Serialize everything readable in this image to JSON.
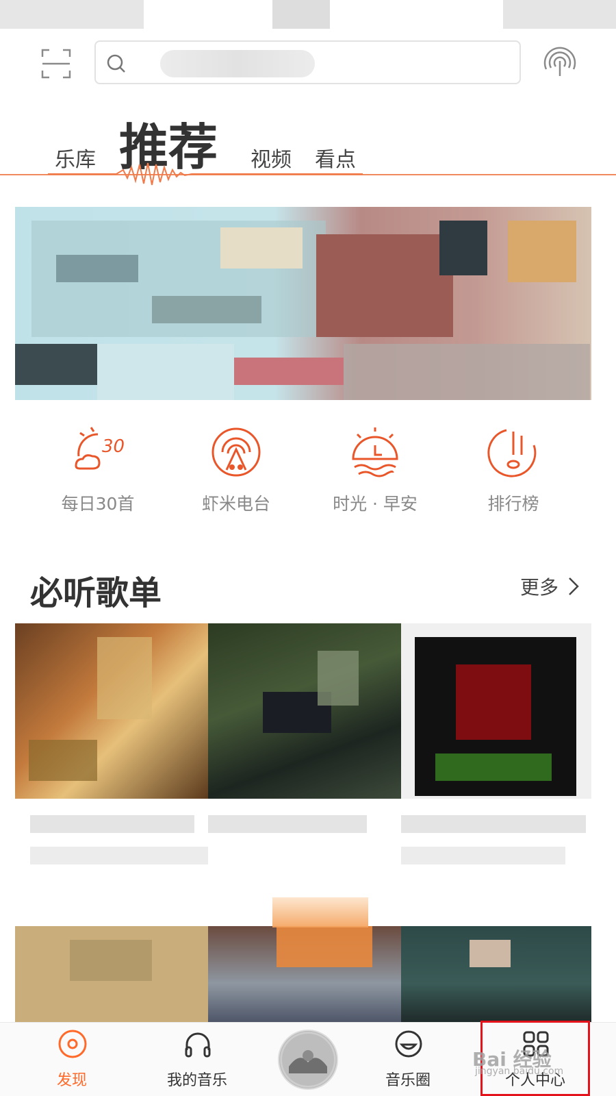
{
  "tabs": {
    "library": "乐库",
    "recommend": "推荐",
    "video": "视频",
    "highlights": "看点"
  },
  "quick_entries": [
    {
      "label": "每日30首",
      "icon": "daily-30-icon"
    },
    {
      "label": "虾米电台",
      "icon": "radio-icon"
    },
    {
      "label": "时光 · 早安",
      "icon": "sunrise-icon"
    },
    {
      "label": "排行榜",
      "icon": "ranking-icon"
    }
  ],
  "section": {
    "title": "必听歌单",
    "more": "更多"
  },
  "bottom_nav": {
    "discover": "发现",
    "my_music": "我的音乐",
    "music_circle": "音乐圈",
    "profile": "个人中心"
  },
  "watermark": {
    "text": "Bai 经验",
    "sub": "jingyan.baidu.com"
  },
  "colors": {
    "accent": "#ff6a2a",
    "highlight_box": "#e4121b"
  }
}
